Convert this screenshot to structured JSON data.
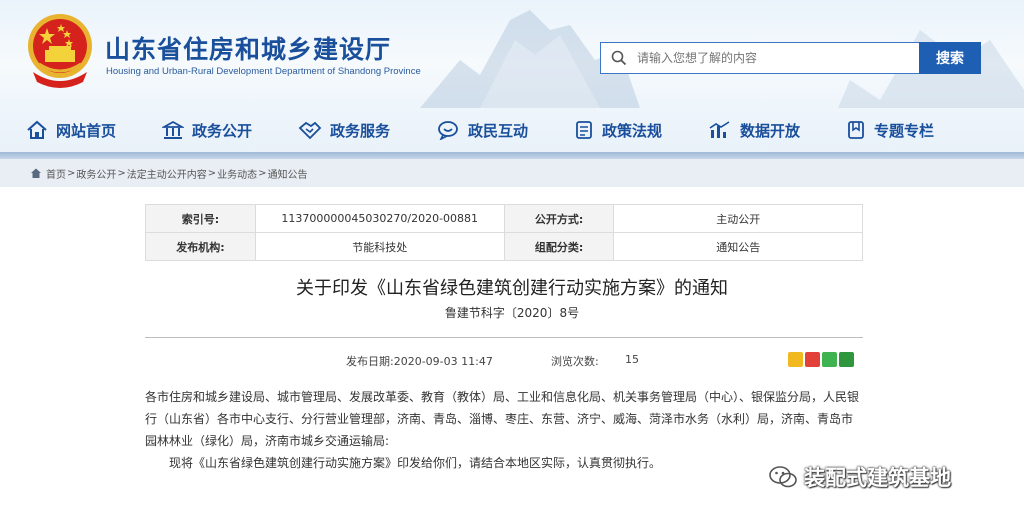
{
  "header": {
    "title": "山东省住房和城乡建设厅",
    "subtitle": "Housing and Urban-Rural Development Department of Shandong Province",
    "search_placeholder": "请输入您想了解的内容",
    "search_button": "搜索"
  },
  "nav": {
    "items": [
      {
        "label": "网站首页",
        "icon": "home-icon"
      },
      {
        "label": "政务公开",
        "icon": "building-icon"
      },
      {
        "label": "政务服务",
        "icon": "handshake-icon"
      },
      {
        "label": "政民互动",
        "icon": "chat-icon"
      },
      {
        "label": "政策法规",
        "icon": "document-icon"
      },
      {
        "label": "数据开放",
        "icon": "chart-icon"
      },
      {
        "label": "专题专栏",
        "icon": "bookmark-icon"
      }
    ]
  },
  "breadcrumb": [
    "首页",
    "政务公开",
    "法定主动公开内容",
    "业务动态",
    "通知公告"
  ],
  "info": {
    "index_label": "索引号:",
    "index_value": "113700000045030270/2020-00881",
    "publish_mode_label": "公开方式:",
    "publish_mode_value": "主动公开",
    "issuer_label": "发布机构:",
    "issuer_value": "节能科技处",
    "category_label": "组配分类:",
    "category_value": "通知公告"
  },
  "article": {
    "title": "关于印发《山东省绿色建筑创建行动实施方案》的通知",
    "doc_number": "鲁建节科字〔2020〕8号",
    "publish_date": "发布日期:2020-09-03 11:47",
    "views_label": "浏览次数:",
    "views_value": "15",
    "paragraph1": "各市住房和城乡建设局、城市管理局、发展改革委、教育（教体）局、工业和信息化局、机关事务管理局（中心）、银保监分局，人民银行（山东省）各市中心支行、分行营业管理部，济南、青岛、淄博、枣庄、东营、济宁、威海、菏泽市水务（水利）局，济南、青岛市园林林业（绿化）局，济南市城乡交通运输局:",
    "paragraph2": "现将《山东省绿色建筑创建行动实施方案》印发给你们，请结合本地区实际，认真贯彻执行。"
  },
  "watermark": "装配式建筑基地",
  "colors": {
    "brand_blue": "#1a4f9c",
    "search_button": "#1e5fb4"
  }
}
